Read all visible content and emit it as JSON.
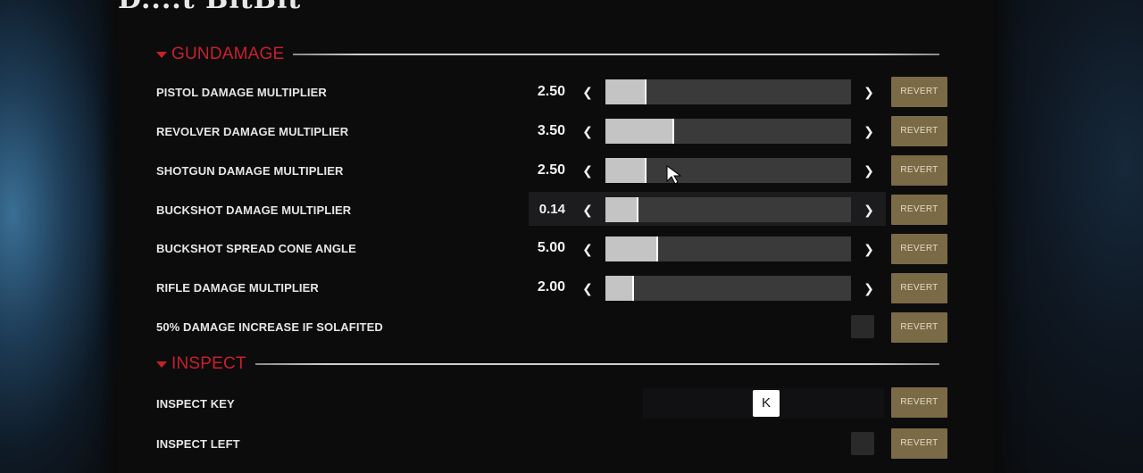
{
  "logo_text": "D....t BitBit",
  "sections": [
    {
      "title": "GUNDAMAGE",
      "rows": [
        {
          "label": "PISTOL DAMAGE MULTIPLIER",
          "value": "2.50",
          "fill": 0.16,
          "revert": "REVERT"
        },
        {
          "label": "REVOLVER DAMAGE MULTIPLIER",
          "value": "3.50",
          "fill": 0.27,
          "revert": "REVERT"
        },
        {
          "label": "SHOTGUN DAMAGE MULTIPLIER",
          "value": "2.50",
          "fill": 0.16,
          "revert": "REVERT"
        },
        {
          "label": "BUCKSHOT DAMAGE MULTIPLIER",
          "value": "0.14",
          "fill": 0.13,
          "revert": "REVERT"
        },
        {
          "label": "BUCKSHOT SPREAD CONE ANGLE",
          "value": "5.00",
          "fill": 0.21,
          "revert": "REVERT"
        },
        {
          "label": "RIFLE DAMAGE MULTIPLIER",
          "value": "2.00",
          "fill": 0.11,
          "revert": "REVERT"
        },
        {
          "label": "50% DAMAGE INCREASE IF SOLAFITED",
          "checked": false,
          "revert": "REVERT"
        }
      ]
    },
    {
      "title": "INSPECT",
      "rows": [
        {
          "label": "INSPECT KEY",
          "key": "K",
          "revert": "REVERT"
        },
        {
          "label": "INSPECT LEFT",
          "checked": false,
          "revert": "REVERT"
        }
      ]
    }
  ],
  "icons": {
    "section_toggle": "triangle-down-icon",
    "decrease": "chevron-left-icon",
    "increase": "chevron-right-icon",
    "cursor": "mouse-pointer-icon"
  },
  "colors": {
    "section_title": "#c8202b",
    "revert_button": "#7a6a45",
    "slider_fill": "#c4c4c4",
    "slider_track": "#3a3a3b"
  }
}
